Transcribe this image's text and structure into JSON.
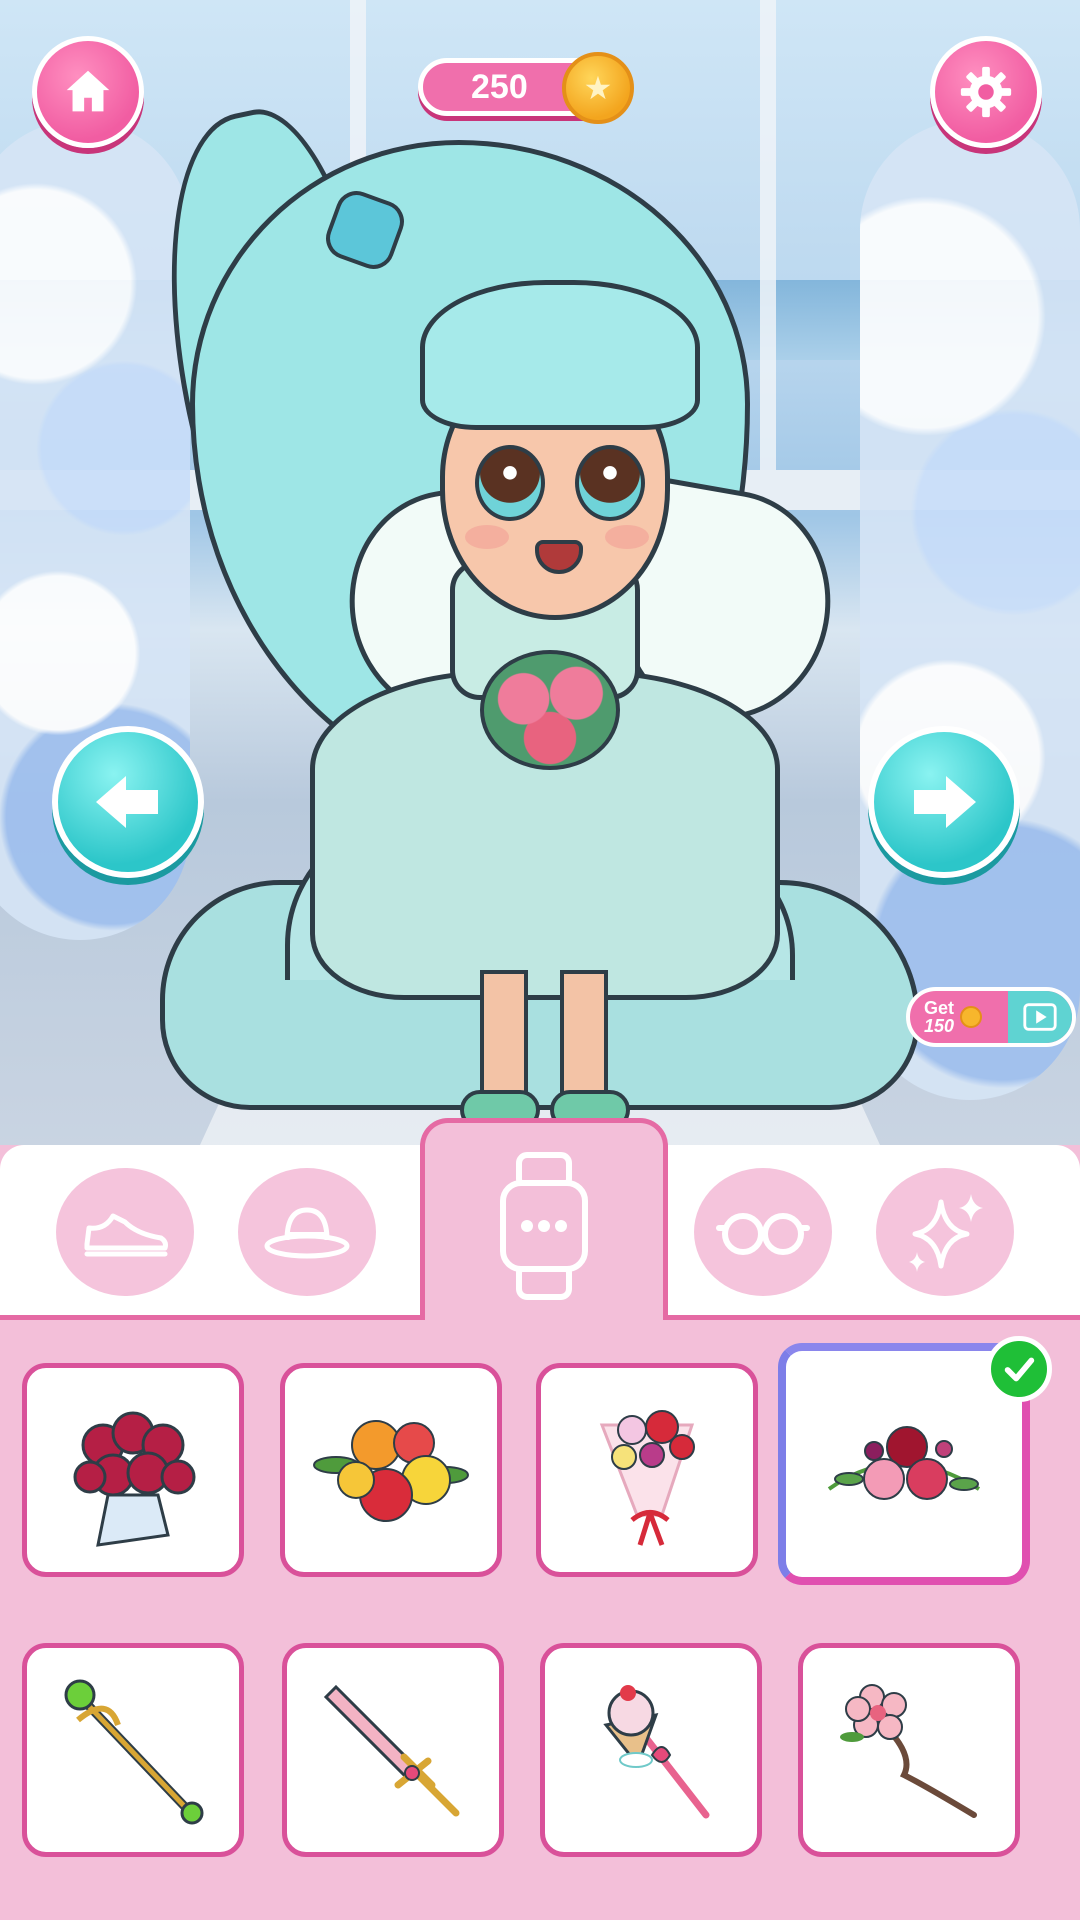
{
  "hud": {
    "coins": "250",
    "coin_icon": "star-coin-icon",
    "home_icon": "home-icon",
    "settings_icon": "gear-icon"
  },
  "reward": {
    "get_label": "Get",
    "amount": "150",
    "video_icon": "play-video-icon"
  },
  "navigation": {
    "prev_icon": "arrow-left-icon",
    "next_icon": "arrow-right-icon"
  },
  "categories": [
    {
      "name": "shoes",
      "icon": "sneaker-icon",
      "active": false
    },
    {
      "name": "hats",
      "icon": "hat-icon",
      "active": false
    },
    {
      "name": "accessories",
      "icon": "watch-icon",
      "active": true
    },
    {
      "name": "glasses",
      "icon": "glasses-icon",
      "active": false
    },
    {
      "name": "effects",
      "icon": "sparkle-icon",
      "active": false
    }
  ],
  "items": [
    {
      "icon": "red-rose-bouquet-icon",
      "selected": false
    },
    {
      "icon": "mixed-rose-bouquet-icon",
      "selected": false
    },
    {
      "icon": "wrapped-flower-bouquet-icon",
      "selected": false
    },
    {
      "icon": "pink-flower-bouquet-icon",
      "selected": true
    },
    {
      "icon": "green-orb-staff-icon",
      "selected": false
    },
    {
      "icon": "pink-sword-icon",
      "selected": false
    },
    {
      "icon": "ice-cream-wand-icon",
      "selected": false
    },
    {
      "icon": "sakura-branch-wand-icon",
      "selected": false
    }
  ],
  "colors": {
    "accent_pink": "#f06fac",
    "tab_border": "#e56aa4",
    "panel_bg": "#f3bfd9",
    "nav_cyan": "#2cc6c9",
    "check_green": "#1fbf37"
  }
}
